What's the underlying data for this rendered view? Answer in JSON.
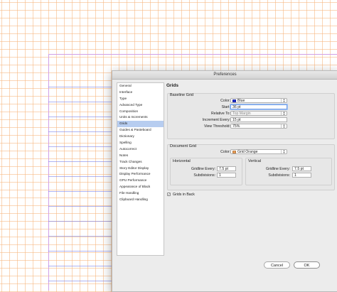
{
  "dialog": {
    "title": "Preferences",
    "section_title": "Grids"
  },
  "sidebar": {
    "items": [
      {
        "label": "General"
      },
      {
        "label": "Interface"
      },
      {
        "label": "Type"
      },
      {
        "label": "Advanced Type"
      },
      {
        "label": "Composition"
      },
      {
        "label": "Units & Increments"
      },
      {
        "label": "Grids",
        "selected": true
      },
      {
        "label": "Guides & Pasteboard"
      },
      {
        "label": "Dictionary"
      },
      {
        "label": "Spelling"
      },
      {
        "label": "Autocorrect"
      },
      {
        "label": "Notes"
      },
      {
        "label": "Track Changes"
      },
      {
        "label": "Story Editor Display"
      },
      {
        "label": "Display Performance"
      },
      {
        "label": "GPU Performance"
      },
      {
        "label": "Appearance of Black"
      },
      {
        "label": "File Handling"
      },
      {
        "label": "Clipboard Handling"
      }
    ]
  },
  "baseline_grid": {
    "label": "Baseline Grid",
    "color_label": "Color:",
    "color_value": "Blue",
    "color_swatch": "#1f2fd6",
    "start_label": "Start:",
    "start_value": "36 pt",
    "relative_to_label": "Relative To:",
    "relative_to_value": "Top Margin",
    "increment_label": "Increment Every:",
    "increment_value": "15 pt",
    "view_threshold_label": "View Threshold:",
    "view_threshold_value": "75%"
  },
  "document_grid": {
    "label": "Document Grid",
    "color_label": "Color:",
    "color_value": "Grid Orange",
    "color_swatch": "#f2a35a",
    "horizontal": {
      "label": "Horizontal",
      "gridline_label": "Gridline Every:",
      "gridline_value": "7.5 pt",
      "subdivisions_label": "Subdivisions:",
      "subdivisions_value": "1"
    },
    "vertical": {
      "label": "Vertical",
      "gridline_label": "Gridline Every:",
      "gridline_value": "7.5 pt",
      "subdivisions_label": "Subdivisions:",
      "subdivisions_value": "1"
    }
  },
  "grids_in_back": {
    "label": "Grids in Back",
    "checked": true
  },
  "buttons": {
    "cancel": "Cancel",
    "ok": "OK"
  },
  "colors": {
    "document_grid_lines": "#f6b278",
    "baseline_grid_lines": "#6e78eb",
    "selection": "#b7cdf0"
  }
}
